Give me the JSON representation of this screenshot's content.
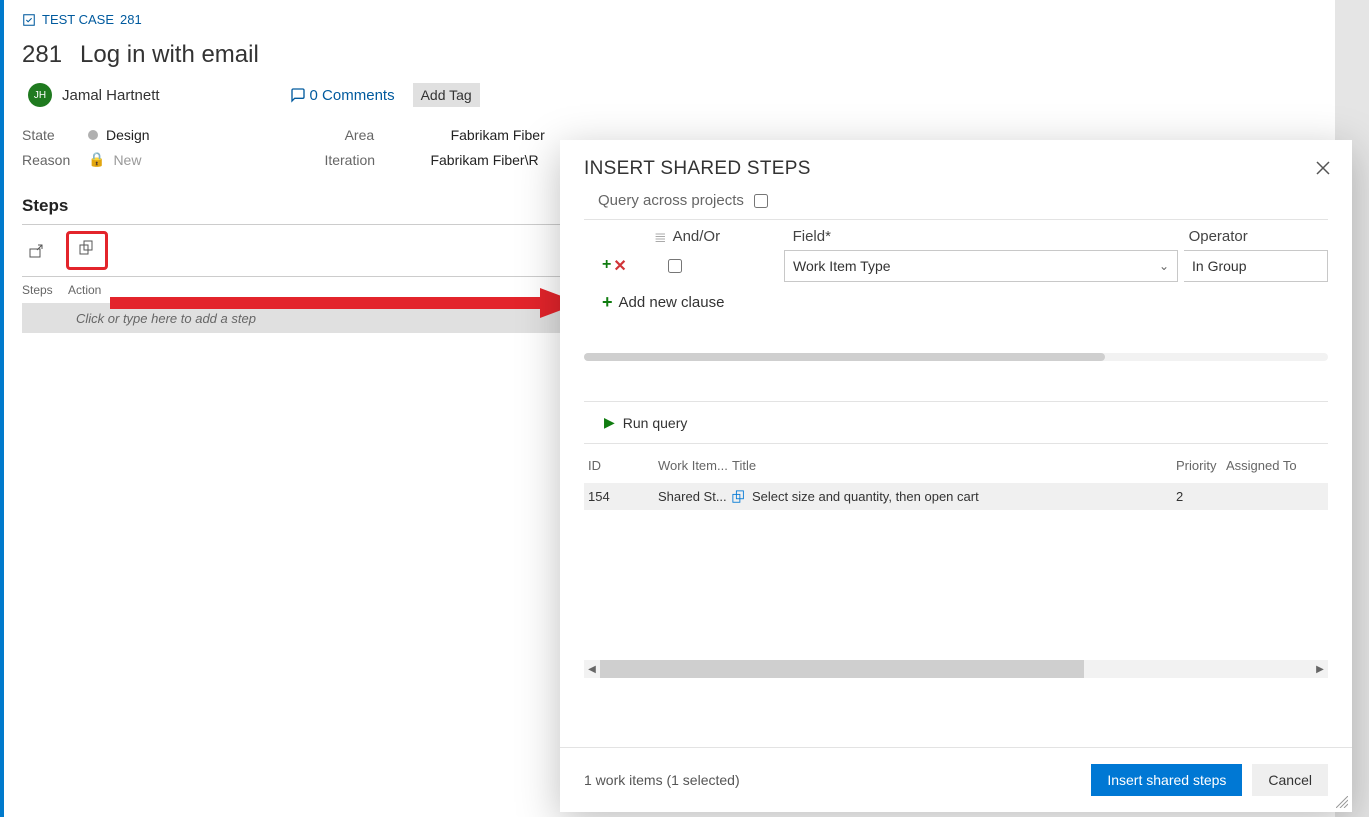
{
  "breadcrumb": {
    "type_label": "TEST CASE",
    "id": "281"
  },
  "workitem": {
    "id": "281",
    "title": "Log in with email",
    "owner_initials": "JH",
    "owner_name": "Jamal Hartnett",
    "comments_count": "0 Comments",
    "add_tag_label": "Add Tag",
    "state_label": "State",
    "state_value": "Design",
    "reason_label": "Reason",
    "reason_value": "New",
    "area_label": "Area",
    "area_value": "Fabrikam Fiber",
    "iteration_label": "Iteration",
    "iteration_value": "Fabrikam Fiber\\R"
  },
  "steps": {
    "section_title": "Steps",
    "col_steps": "Steps",
    "col_action": "Action",
    "placeholder": "Click or type here to add a step"
  },
  "dialog": {
    "title": "INSERT SHARED STEPS",
    "query_across_label": "Query across projects",
    "headers": {
      "andor": "And/Or",
      "field": "Field*",
      "operator": "Operator"
    },
    "clause": {
      "field_value": "Work Item Type",
      "operator_value": "In Group"
    },
    "add_clause_label": "Add new clause",
    "run_query_label": "Run query",
    "results": {
      "cols": {
        "id": "ID",
        "wit": "Work Item...",
        "title": "Title",
        "priority": "Priority",
        "assigned": "Assigned To"
      },
      "row": {
        "id": "154",
        "wit": "Shared St...",
        "title": "Select size and quantity, then open cart",
        "priority": "2",
        "assigned": ""
      }
    },
    "footer_status": "1 work items (1 selected)",
    "insert_label": "Insert shared steps",
    "cancel_label": "Cancel"
  }
}
